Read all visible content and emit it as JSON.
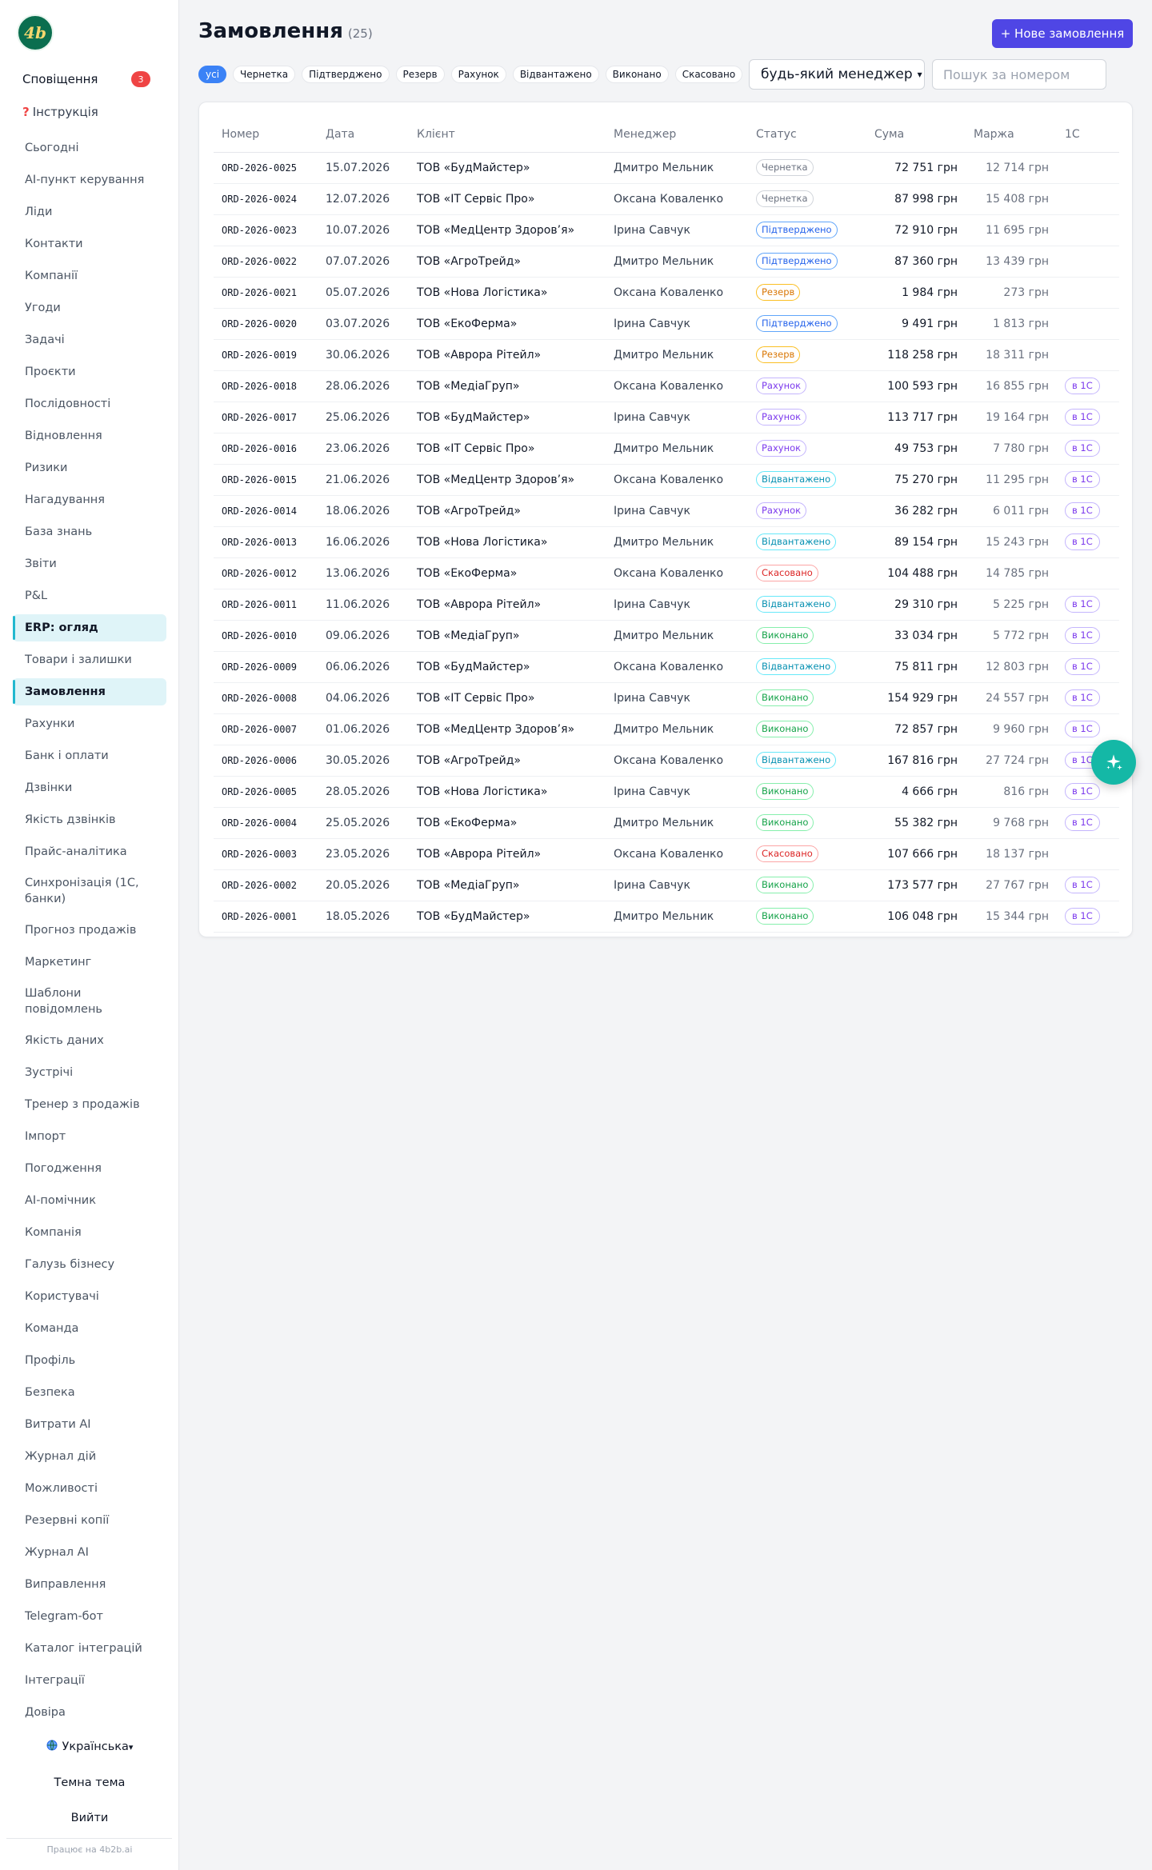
{
  "sidebar": {
    "logo": "4b",
    "notifications_label": "Сповіщення",
    "notifications_count": "3",
    "help_label": "Інструкція",
    "nav": [
      "Сьогодні",
      "AI-пункт керування",
      "Ліди",
      "Контакти",
      "Компанії",
      "Угоди",
      "Задачі",
      "Проєкти",
      "Послідовності",
      "Відновлення",
      "Ризики",
      "Нагадування",
      "База знань",
      "Звіти",
      "P&L",
      "ERP: огляд",
      "Товари і залишки",
      "Замовлення",
      "Рахунки",
      "Банк і оплати",
      "Дзвінки",
      "Якість дзвінків",
      "Прайс-аналітика",
      "Синхронізація (1С, банки)",
      "Прогноз продажів",
      "Маркетинг",
      "Шаблони повідомлень",
      "Якість даних",
      "Зустрічі",
      "Тренер з продажів",
      "Імпорт",
      "Погодження",
      "AI-помічник",
      "Компанія",
      "Галузь бізнесу",
      "Користувачі",
      "Команда",
      "Профіль",
      "Безпека",
      "Витрати AI",
      "Журнал дій",
      "Можливості",
      "Резервні копії",
      "Журнал AI",
      "Виправлення",
      "Telegram-бот",
      "Каталог інтеграцій",
      "Інтеграції",
      "Довіра"
    ],
    "active": [
      "ERP: огляд",
      "Замовлення"
    ],
    "language": "Українська",
    "theme_label": "Темна тема",
    "logout_label": "Вийти",
    "powered_by": "Працює на 4b2b.ai"
  },
  "header": {
    "title": "Замовлення",
    "count": "(25)",
    "new_button": "+ Нове замовлення"
  },
  "filters": {
    "chips": [
      "усі",
      "Чернетка",
      "Підтверджено",
      "Резерв",
      "Рахунок",
      "Відвантажено",
      "Виконано",
      "Скасовано"
    ],
    "active_chip": "усі",
    "manager_select": "будь-який менеджер",
    "search_placeholder": "Пошук за номером"
  },
  "table": {
    "columns": [
      "Номер",
      "Дата",
      "Клієнт",
      "Менеджер",
      "Статус",
      "Сума",
      "Маржа",
      "1С"
    ],
    "rows": [
      {
        "num": "ORD-2026-0025",
        "date": "15.07.2026",
        "client": "ТОВ «БудМайстер»",
        "manager": "Дмитро Мельник",
        "status": "Чернетка",
        "sum": "72 751 грн",
        "margin": "12 714 грн",
        "onec": ""
      },
      {
        "num": "ORD-2026-0024",
        "date": "12.07.2026",
        "client": "ТОВ «IT Сервіс Про»",
        "manager": "Оксана Коваленко",
        "status": "Чернетка",
        "sum": "87 998 грн",
        "margin": "15 408 грн",
        "onec": ""
      },
      {
        "num": "ORD-2026-0023",
        "date": "10.07.2026",
        "client": "ТОВ «МедЦентр Здоров’я»",
        "manager": "Ірина Савчук",
        "status": "Підтверджено",
        "sum": "72 910 грн",
        "margin": "11 695 грн",
        "onec": ""
      },
      {
        "num": "ORD-2026-0022",
        "date": "07.07.2026",
        "client": "ТОВ «АгроТрейд»",
        "manager": "Дмитро Мельник",
        "status": "Підтверджено",
        "sum": "87 360 грн",
        "margin": "13 439 грн",
        "onec": ""
      },
      {
        "num": "ORD-2026-0021",
        "date": "05.07.2026",
        "client": "ТОВ «Нова Логістика»",
        "manager": "Оксана Коваленко",
        "status": "Резерв",
        "sum": "1 984 грн",
        "margin": "273 грн",
        "onec": ""
      },
      {
        "num": "ORD-2026-0020",
        "date": "03.07.2026",
        "client": "ТОВ «ЕкоФерма»",
        "manager": "Ірина Савчук",
        "status": "Підтверджено",
        "sum": "9 491 грн",
        "margin": "1 813 грн",
        "onec": ""
      },
      {
        "num": "ORD-2026-0019",
        "date": "30.06.2026",
        "client": "ТОВ «Аврора Рітейл»",
        "manager": "Дмитро Мельник",
        "status": "Резерв",
        "sum": "118 258 грн",
        "margin": "18 311 грн",
        "onec": ""
      },
      {
        "num": "ORD-2026-0018",
        "date": "28.06.2026",
        "client": "ТОВ «МедіаГруп»",
        "manager": "Оксана Коваленко",
        "status": "Рахунок",
        "sum": "100 593 грн",
        "margin": "16 855 грн",
        "onec": "в 1С"
      },
      {
        "num": "ORD-2026-0017",
        "date": "25.06.2026",
        "client": "ТОВ «БудМайстер»",
        "manager": "Ірина Савчук",
        "status": "Рахунок",
        "sum": "113 717 грн",
        "margin": "19 164 грн",
        "onec": "в 1С"
      },
      {
        "num": "ORD-2026-0016",
        "date": "23.06.2026",
        "client": "ТОВ «IT Сервіс Про»",
        "manager": "Дмитро Мельник",
        "status": "Рахунок",
        "sum": "49 753 грн",
        "margin": "7 780 грн",
        "onec": "в 1С"
      },
      {
        "num": "ORD-2026-0015",
        "date": "21.06.2026",
        "client": "ТОВ «МедЦентр Здоров’я»",
        "manager": "Оксана Коваленко",
        "status": "Відвантажено",
        "sum": "75 270 грн",
        "margin": "11 295 грн",
        "onec": "в 1С"
      },
      {
        "num": "ORD-2026-0014",
        "date": "18.06.2026",
        "client": "ТОВ «АгроТрейд»",
        "manager": "Ірина Савчук",
        "status": "Рахунок",
        "sum": "36 282 грн",
        "margin": "6 011 грн",
        "onec": "в 1С"
      },
      {
        "num": "ORD-2026-0013",
        "date": "16.06.2026",
        "client": "ТОВ «Нова Логістика»",
        "manager": "Дмитро Мельник",
        "status": "Відвантажено",
        "sum": "89 154 грн",
        "margin": "15 243 грн",
        "onec": "в 1С"
      },
      {
        "num": "ORD-2026-0012",
        "date": "13.06.2026",
        "client": "ТОВ «ЕкоФерма»",
        "manager": "Оксана Коваленко",
        "status": "Скасовано",
        "sum": "104 488 грн",
        "margin": "14 785 грн",
        "onec": ""
      },
      {
        "num": "ORD-2026-0011",
        "date": "11.06.2026",
        "client": "ТОВ «Аврора Рітейл»",
        "manager": "Ірина Савчук",
        "status": "Відвантажено",
        "sum": "29 310 грн",
        "margin": "5 225 грн",
        "onec": "в 1С"
      },
      {
        "num": "ORD-2026-0010",
        "date": "09.06.2026",
        "client": "ТОВ «МедіаГруп»",
        "manager": "Дмитро Мельник",
        "status": "Виконано",
        "sum": "33 034 грн",
        "margin": "5 772 грн",
        "onec": "в 1С"
      },
      {
        "num": "ORD-2026-0009",
        "date": "06.06.2026",
        "client": "ТОВ «БудМайстер»",
        "manager": "Оксана Коваленко",
        "status": "Відвантажено",
        "sum": "75 811 грн",
        "margin": "12 803 грн",
        "onec": "в 1С"
      },
      {
        "num": "ORD-2026-0008",
        "date": "04.06.2026",
        "client": "ТОВ «IT Сервіс Про»",
        "manager": "Ірина Савчук",
        "status": "Виконано",
        "sum": "154 929 грн",
        "margin": "24 557 грн",
        "onec": "в 1С"
      },
      {
        "num": "ORD-2026-0007",
        "date": "01.06.2026",
        "client": "ТОВ «МедЦентр Здоров’я»",
        "manager": "Дмитро Мельник",
        "status": "Виконано",
        "sum": "72 857 грн",
        "margin": "9 960 грн",
        "onec": "в 1С"
      },
      {
        "num": "ORD-2026-0006",
        "date": "30.05.2026",
        "client": "ТОВ «АгроТрейд»",
        "manager": "Оксана Коваленко",
        "status": "Відвантажено",
        "sum": "167 816 грн",
        "margin": "27 724 грн",
        "onec": "в 1С"
      },
      {
        "num": "ORD-2026-0005",
        "date": "28.05.2026",
        "client": "ТОВ «Нова Логістика»",
        "manager": "Ірина Савчук",
        "status": "Виконано",
        "sum": "4 666 грн",
        "margin": "816 грн",
        "onec": "в 1С"
      },
      {
        "num": "ORD-2026-0004",
        "date": "25.05.2026",
        "client": "ТОВ «ЕкоФерма»",
        "manager": "Дмитро Мельник",
        "status": "Виконано",
        "sum": "55 382 грн",
        "margin": "9 768 грн",
        "onec": "в 1С"
      },
      {
        "num": "ORD-2026-0003",
        "date": "23.05.2026",
        "client": "ТОВ «Аврора Рітейл»",
        "manager": "Оксана Коваленко",
        "status": "Скасовано",
        "sum": "107 666 грн",
        "margin": "18 137 грн",
        "onec": ""
      },
      {
        "num": "ORD-2026-0002",
        "date": "20.05.2026",
        "client": "ТОВ «МедіаГруп»",
        "manager": "Ірина Савчук",
        "status": "Виконано",
        "sum": "173 577 грн",
        "margin": "27 767 грн",
        "onec": "в 1С"
      },
      {
        "num": "ORD-2026-0001",
        "date": "18.05.2026",
        "client": "ТОВ «БудМайстер»",
        "manager": "Дмитро Мельник",
        "status": "Виконано",
        "sum": "106 048 грн",
        "margin": "15 344 грн",
        "onec": "в 1С"
      }
    ]
  },
  "status_colors": {
    "Чернетка": "#6b7280",
    "Підтверджено": "#2563eb",
    "Резерв": "#d97706",
    "Рахунок": "#7c3aed",
    "Відвантажено": "#0891b2",
    "Виконано": "#16a34a",
    "Скасовано": "#dc2626"
  },
  "icons": {
    "fab": "sparkles-icon",
    "language": "globe-icon",
    "help": "question-icon"
  },
  "colors": {
    "accent": "#4f46e5",
    "filter_active": "#3b82f6",
    "fab": "#14b8a6",
    "logo_bg": "#0b6e4f",
    "badge": "#ef4444"
  }
}
